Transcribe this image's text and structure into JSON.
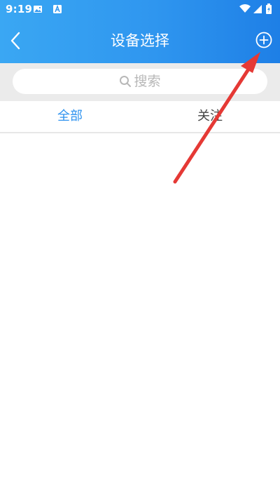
{
  "status_bar": {
    "time": "9:19",
    "left_icons": [
      "image-notification-icon",
      "app-notification-icon"
    ],
    "right_icons": [
      "wifi-icon",
      "signal-icon",
      "battery-charging-icon"
    ]
  },
  "header": {
    "title": "设备选择",
    "back_icon": "chevron-left-icon",
    "add_icon": "add-circle-icon",
    "gradient_colors": [
      "#3aa7f3",
      "#1e7fe6"
    ]
  },
  "search": {
    "icon": "search-icon",
    "placeholder": "搜索"
  },
  "tabs": [
    {
      "label": "全部",
      "active": true
    },
    {
      "label": "关注",
      "active": false
    }
  ],
  "annotation": {
    "type": "red-arrow",
    "color": "#e53935",
    "points_to": "add-button"
  },
  "colors": {
    "accent": "#2f93ef",
    "search_band": "#ebebeb",
    "inactive_tab": "#444444"
  }
}
